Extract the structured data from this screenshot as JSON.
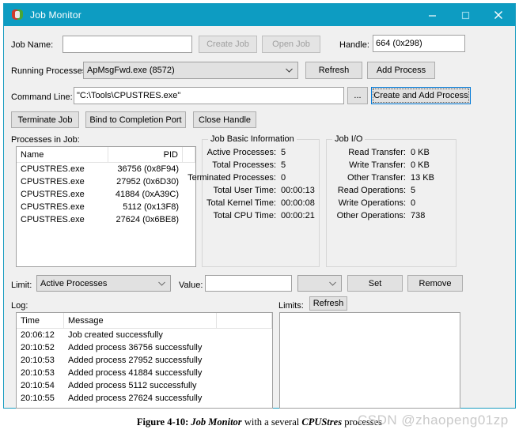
{
  "window": {
    "title": "Job Monitor",
    "icon": "shield-icon",
    "minimize_label": "─",
    "maximize_label": "□",
    "close_label": "✕",
    "titlebar_color": "#0d9cc2"
  },
  "job_name_row": {
    "label": "Job Name:",
    "value": "",
    "placeholder": "",
    "create_job": "Create Job",
    "open_job": "Open Job",
    "handle_label": "Handle:",
    "handle_value": "664 (0x298)"
  },
  "running_processes_row": {
    "label": "Running Processes:",
    "selected": "ApMsgFwd.exe (8572)",
    "refresh": "Refresh",
    "add_process": "Add Process"
  },
  "command_line_row": {
    "label": "Command Line:",
    "value": "\"C:\\Tools\\CPUSTRES.exe\"",
    "browse": "...",
    "create_and_add": "Create and Add Process"
  },
  "action_buttons": {
    "terminate_job": "Terminate Job",
    "bind_to_completion_port": "Bind to Completion Port",
    "close_handle": "Close Handle"
  },
  "processes_in_job": {
    "label": "Processes in Job:",
    "columns": [
      "Name",
      "PID"
    ],
    "rows": [
      {
        "name": "CPUSTRES.exe",
        "pid": "36756 (0x8F94)"
      },
      {
        "name": "CPUSTRES.exe",
        "pid": "27952 (0x6D30)"
      },
      {
        "name": "CPUSTRES.exe",
        "pid": "41884 (0xA39C)"
      },
      {
        "name": "CPUSTRES.exe",
        "pid": "5112 (0x13F8)"
      },
      {
        "name": "CPUSTRES.exe",
        "pid": "27624 (0x6BE8)"
      }
    ]
  },
  "job_basic_information": {
    "title": "Job Basic Information",
    "rows": [
      {
        "key": "Active Processes:",
        "value": "5"
      },
      {
        "key": "Total Processes:",
        "value": "5"
      },
      {
        "key": "Terminated Processes:",
        "value": "0"
      },
      {
        "key": "Total User Time:",
        "value": "00:00:13"
      },
      {
        "key": "Total Kernel Time:",
        "value": "00:00:08"
      },
      {
        "key": "Total CPU Time:",
        "value": "00:00:21"
      }
    ]
  },
  "job_io": {
    "title": "Job I/O",
    "rows": [
      {
        "key": "Read Transfer:",
        "value": "0 KB"
      },
      {
        "key": "Write Transfer:",
        "value": "0 KB"
      },
      {
        "key": "Other Transfer:",
        "value": "13 KB"
      },
      {
        "key": "Read Operations:",
        "value": "5"
      },
      {
        "key": "Write Operations:",
        "value": "0"
      },
      {
        "key": "Other Operations:",
        "value": "738"
      }
    ]
  },
  "limit_row": {
    "label": "Limit:",
    "selected": "Active Processes",
    "value_label": "Value:",
    "value": "",
    "units_selected": "",
    "set": "Set",
    "remove": "Remove"
  },
  "log": {
    "label": "Log:",
    "columns": [
      "Time",
      "Message"
    ],
    "rows": [
      {
        "time": "20:06:12",
        "message": "Job created successfully"
      },
      {
        "time": "20:10:52",
        "message": "Added process 36756 successfully"
      },
      {
        "time": "20:10:53",
        "message": "Added process 27952 successfully"
      },
      {
        "time": "20:10:53",
        "message": "Added process 41884 successfully"
      },
      {
        "time": "20:10:54",
        "message": "Added process 5112 successfully"
      },
      {
        "time": "20:10:55",
        "message": "Added process 27624 successfully"
      }
    ]
  },
  "limits_panel": {
    "label": "Limits:",
    "refresh": "Refresh",
    "rows": []
  },
  "caption": {
    "prefix": "Figure 4-10: ",
    "app": "Job Monitor",
    "middle": " with a several ",
    "tool": "CPUStres",
    "suffix": " processes"
  },
  "watermark": {
    "text": "CSDN @zhaopeng01zp"
  }
}
